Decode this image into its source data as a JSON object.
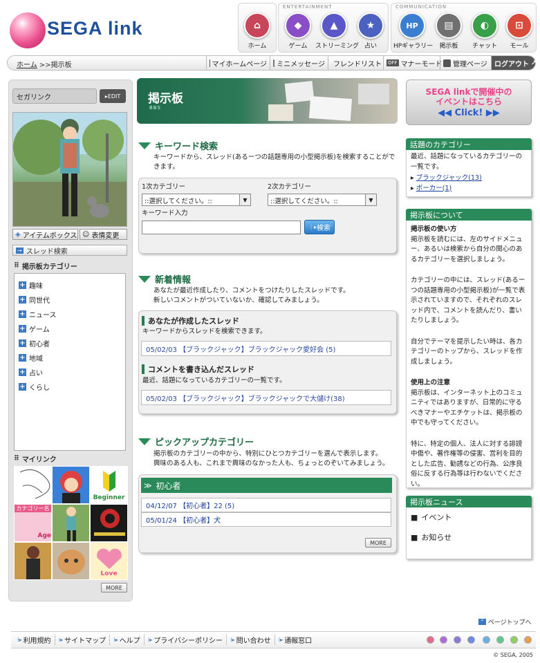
{
  "brand": {
    "logo_text": "SEGA link"
  },
  "nav": {
    "entertainment_label": "ENTERTAINMENT",
    "communication_label": "COMMUNICATION",
    "items": [
      {
        "label": "ホーム",
        "icon": "home-icon",
        "color": "#c8465a"
      },
      {
        "label": "ゲーム",
        "icon": "game-icon",
        "color": "#8a4fc8"
      },
      {
        "label": "ストリーミング",
        "icon": "streaming-icon",
        "color": "#5a58c8"
      },
      {
        "label": "占い",
        "icon": "star-icon",
        "color": "#4c62c0"
      },
      {
        "label": "HPギャラリー",
        "icon": "hp-icon",
        "color": "#3a7ed0"
      },
      {
        "label": "掲示板",
        "icon": "board-icon",
        "color": "#707070"
      },
      {
        "label": "チャット",
        "icon": "chat-icon",
        "color": "#38a048"
      },
      {
        "label": "モール",
        "icon": "cart-icon",
        "color": "#d84a3a"
      }
    ]
  },
  "breadcrumb": {
    "home": "ホーム",
    "separator": ">>",
    "current": "掲示板"
  },
  "toolbar": {
    "my_home": "マイホームページ",
    "mini_message": "ミニメッセージ",
    "friend_list": "フレンドリスト",
    "off_badge": "OFF",
    "manner_mode": "マナーモード",
    "admin_page": "管理ページ",
    "logout": "ログアウト"
  },
  "profile": {
    "name": "セガリンク",
    "edit_label": "EDIT"
  },
  "left": {
    "item_box": "アイテムボックス",
    "expression_change": "表情変更",
    "thread_search": "スレッド検索",
    "board_category": "掲示板カテゴリー",
    "categories": [
      "趣味",
      "同世代",
      "ニュース",
      "ゲーム",
      "初心者",
      "地域",
      "占い",
      "くらし"
    ],
    "mylink": "マイリンク",
    "mylink_texts": {
      "beginner": "Beginner",
      "cat_name": "カテゴリー名",
      "age": "Age",
      "love": "Love"
    },
    "more": "MORE"
  },
  "banner": {
    "title": "掲示板",
    "subtitle": "BBS"
  },
  "keyword": {
    "title": "キーワード検索",
    "desc": "キーワードから、スレッド(あるーつの話題専用の小型掲示板)を検索することができます。",
    "cat1_label": "1次カテゴリー",
    "cat2_label": "2次カテゴリー",
    "cat1_value": "::選択してください。::",
    "cat2_value": "::選択してください。::",
    "input_label": "キーワード入力",
    "search_button": "検索"
  },
  "news": {
    "title": "新着情報",
    "desc1": "あなたが最近作成したり、コメントをつけたりしたスレッドです。",
    "desc2": "新しいコメントがついていないか、確認してみましょう。",
    "created_title": "あなたが作成したスレッド",
    "created_desc": "キーワードからスレッドを検索できます。",
    "created_item": "05/02/03 【ブラックジャック】ブラックジャック愛好会 (5)",
    "comment_title": "コメントを書き込んだスレッド",
    "comment_desc": "最近、話題になっているカテゴリーの一覧です。",
    "comment_item": "05/02/03 【ブラックジャック】ブラックジャックで大儲け(38)"
  },
  "pickup": {
    "title": "ピックアップカテゴリー",
    "desc1": "掲示板のカテゴリーの中から、特別にひとつカテゴリーを選んで表示します。",
    "desc2": "興味のある人も、これまで興味のなかった人も、ちょっとのぞいてみましょう。",
    "category": "初心者",
    "items": [
      "04/12/07 【初心者】22 (5)",
      "05/01/24 【初心者】犬"
    ],
    "more": "MORE"
  },
  "right": {
    "promo_line1": "SEGA linkで開催中の",
    "promo_line2": "イベントはこちら",
    "promo_click": "◀◀ Click! ▶▶",
    "hot_title": "話題のカテゴリー",
    "hot_desc": "最近、話題になっているカテゴリーの一覧です。",
    "hot_items": [
      "ブラックジャック(13)",
      "ポーカー(1)"
    ],
    "about_title": "掲示板について",
    "about_h1": "掲示板の使い方",
    "about_p1": "掲示板を読むには、左のサイドメニュー、あるいは検索から自分の関心のあるカテゴリーを選択しましょう。",
    "about_p2": "カテゴリーの中には、スレッド(あるーつの話題専用の小型掲示板)が一覧で表示されていますので、それぞれのスレッド内で、コメントを読んだり、書いたりしましょう。",
    "about_p3": "自分でテーマを提示したい時は、各カテゴリーのトップから、スレッドを作成しましょう。",
    "about_h2": "使用上の注意",
    "about_p4": "掲示板は、インターネット上のコミュニティではありますが、日常的に守るべきマナーやエチケットは、掲示板の中でも守ってください。",
    "about_p5": "特に、特定の個人、法人に対する誹謗中傷や、著作権等の侵害、営利を目的とした広告、勧誘などの行為、公序良俗に反する行為等は行わないでください。",
    "news_title": "掲示板ニュース",
    "news_items": [
      "イベント",
      "お知らせ"
    ]
  },
  "footer": {
    "page_top": "ページトップへ",
    "links": [
      "利用規約",
      "サイトマップ",
      "ヘルプ",
      "プライバシーポリシー",
      "問い合わせ",
      "通報窓口"
    ],
    "copyright": "© SEGA, 2005",
    "dot_colors": [
      "#e86a8a",
      "#b06ad8",
      "#8a7ad8",
      "#6a8ae0",
      "#6ab0e0",
      "#60c890",
      "#90d060",
      "#e0a050"
    ]
  },
  "colors": {
    "accent": "#2a8a5a",
    "brand": "#1e4f9e",
    "link": "#1a3fa0"
  }
}
